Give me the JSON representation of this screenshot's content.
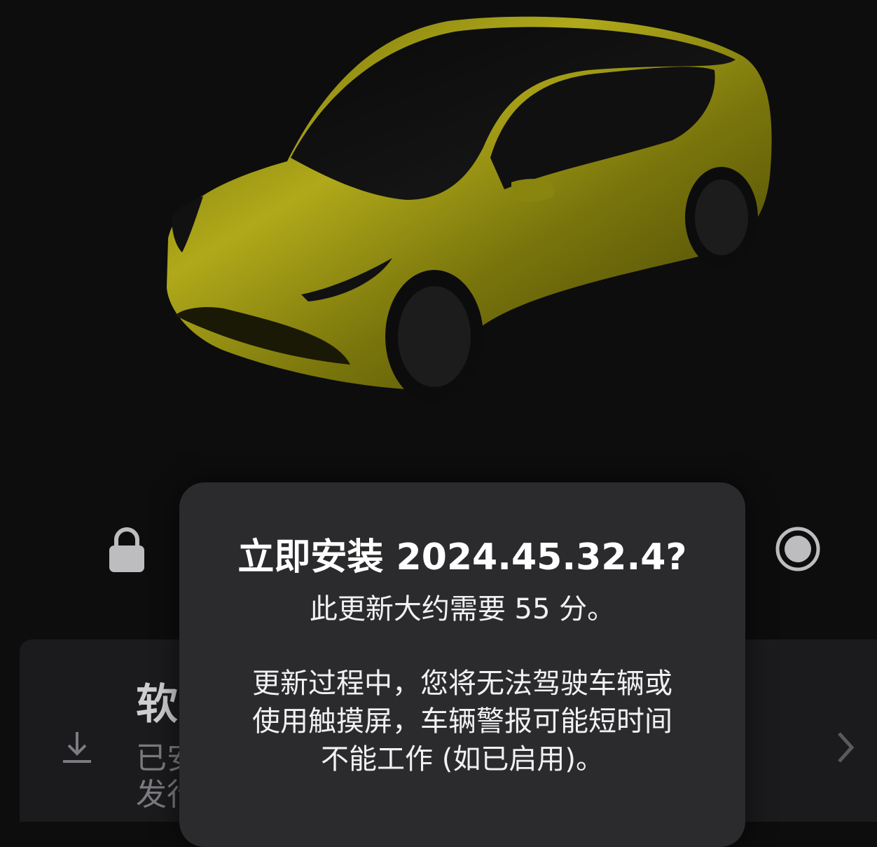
{
  "dialog": {
    "title": "立即安装 2024.45.32.4?",
    "duration": "此更新大约需要 55 分。",
    "body_lines": [
      "更新过程中，您将无法驾驶车辆或",
      "使用触摸屏，车辆警报可能短时间",
      "不能工作 (如已启用)。"
    ]
  },
  "card": {
    "title_partial": "软",
    "subtitle_partial": "已安\n发行"
  },
  "icons": {
    "lock": "lock-icon",
    "record": "target-icon",
    "download": "download-icon",
    "chevron": "chevron-right-icon"
  },
  "colors": {
    "background": "#0d0d0e",
    "car_paint": "#8f8a10",
    "dialog_bg": "#2b2b2e",
    "card_bg": "#1b1b1d"
  }
}
